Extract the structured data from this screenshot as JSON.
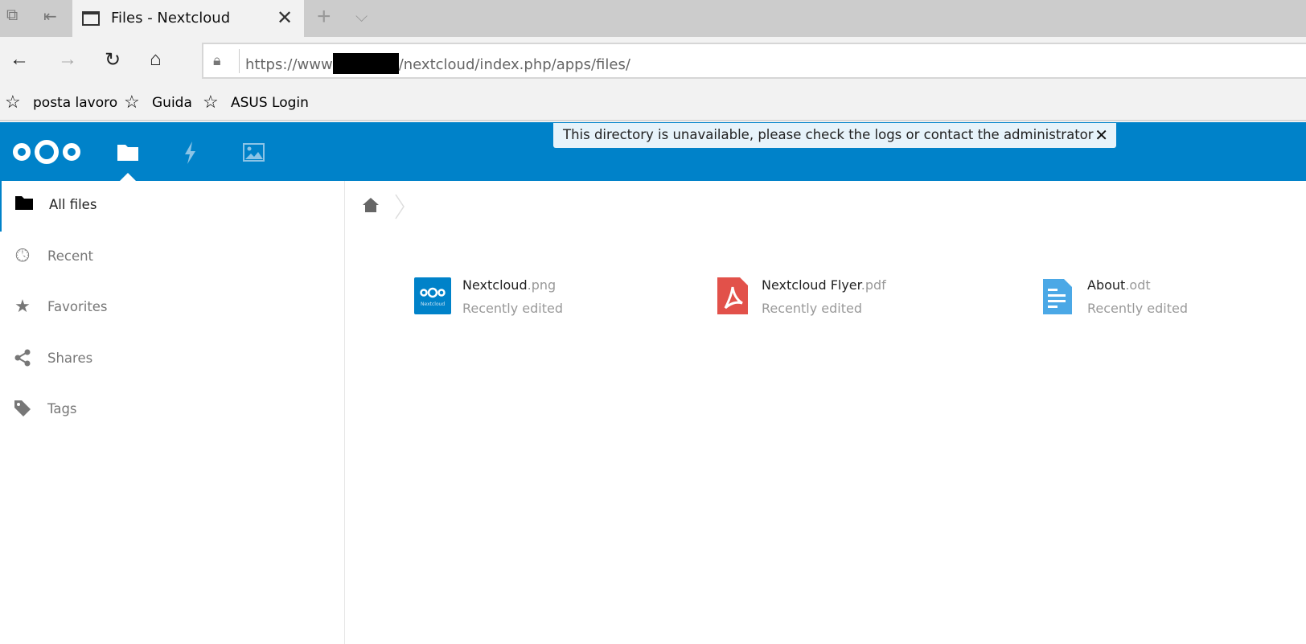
{
  "browser": {
    "tab_title": "Files - Nextcloud",
    "url_prefix": "https://www",
    "url_suffix": "/nextcloud/index.php/apps/files/",
    "bookmarks": [
      "posta lavoro",
      "Guida",
      "ASUS Login"
    ]
  },
  "notification": {
    "text": "This directory is unavailable, please check the logs or contact the administrator"
  },
  "sidebar": {
    "items": [
      {
        "label": "All files"
      },
      {
        "label": "Recent"
      },
      {
        "label": "Favorites"
      },
      {
        "label": "Shares"
      },
      {
        "label": "Tags"
      }
    ]
  },
  "files": [
    {
      "name": "Nextcloud",
      "ext": ".png",
      "status": "Recently edited",
      "thumb_text": "Nextcloud"
    },
    {
      "name": "Nextcloud Flyer",
      "ext": ".pdf",
      "status": "Recently edited"
    },
    {
      "name": "About",
      "ext": ".odt",
      "status": "Recently edited"
    }
  ],
  "colors": {
    "brand": "#0082c9"
  }
}
